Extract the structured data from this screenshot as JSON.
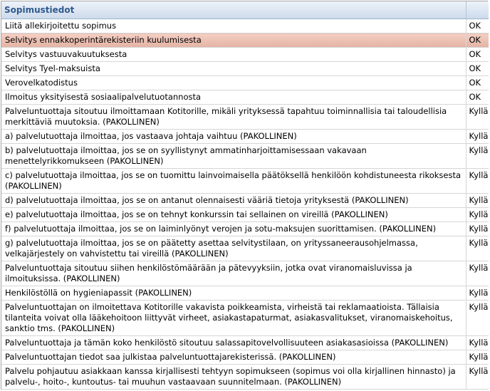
{
  "header": {
    "title": "Sopimustiedot",
    "value_header": ""
  },
  "rows": [
    {
      "label": "Liitä allekirjoitettu sopimus",
      "value": "OK"
    },
    {
      "label": "Selvitys ennakkoperintärekisteriin kuulumisesta",
      "value": "OK",
      "highlighted": true
    },
    {
      "label": "Selvitys vastuuvakuutuksesta",
      "value": "OK"
    },
    {
      "label": "Selvitys Tyel-maksuista",
      "value": "OK"
    },
    {
      "label": "Verovelkatodistus",
      "value": "OK"
    },
    {
      "label": "Ilmoitus yksityisestä sosiaalipalvelutuotannosta",
      "value": "OK"
    },
    {
      "label": "Palveluntuottaja sitoutuu ilmoittamaan Kotitorille, mikäli yrityksessä tapahtuu toiminnallisia tai taloudellisia merkittäviä muutoksia. (PAKOLLINEN)",
      "value": "Kyllä"
    },
    {
      "label": "a) palvelutuottaja ilmoittaa, jos vastaava johtaja vaihtuu (PAKOLLINEN)",
      "value": "Kyllä"
    },
    {
      "label": "b) palvelutuottaja ilmoittaa, jos se on syyllistynyt ammatinharjoittamisessaan vakavaan menettelyrikkomukseen (PAKOLLINEN)",
      "value": "Kyllä"
    },
    {
      "label": "c) palvelutuottaja ilmoittaa, jos se on tuomittu lainvoimaisella päätöksellä henkilöön kohdistuneesta rikoksesta (PAKOLLINEN)",
      "value": "Kyllä"
    },
    {
      "label": "d) palvelutuottaja ilmoittaa, jos se on antanut olennaisesti vääriä tietoja yrityksestä (PAKOLLINEN)",
      "value": "Kyllä"
    },
    {
      "label": "e) palvelutuottaja ilmoittaa, jos se on tehnyt konkurssin tai sellainen on vireillä (PAKOLLINEN)",
      "value": "Kyllä"
    },
    {
      "label": "f) palvelutuottaja ilmoittaa, jos se on laiminlyönyt verojen ja sotu-maksujen suorittamisen. (PAKOLLINEN)",
      "value": "Kyllä"
    },
    {
      "label": "g) palvelutuottaja ilmoittaa, jos se on päätetty asettaa selvitystilaan, on yrityssaneerausohjelmassa, velkajärjestely on vahvistettu tai vireillä (PAKOLLINEN)",
      "value": "Kyllä"
    },
    {
      "label": "Palveluntuottaja sitoutuu siihen henkilöstömäärään ja pätevyyksiin, jotka ovat viranomaisluvissa ja ilmoituksissa. (PAKOLLINEN)",
      "value": "Kyllä"
    },
    {
      "label": "Henkilöstöllä on hygieniapassit (PAKOLLINEN)",
      "value": "Kyllä"
    },
    {
      "label": "Palveluntuottajan on ilmoitettava Kotitorille vakavista poikkeamista, virheistä tai reklamaatioista. Tällaisia tilanteita voivat olla lääkehoitoon liittyvät virheet, asiakastapaturmat, asiakasvalitukset, viranomaiskehoitus, sanktio tms. (PAKOLLINEN)",
      "value": "Kyllä"
    },
    {
      "label": "Palveluntuottaja ja tämän koko henkilöstö sitoutuu salassapitovelvollisuuteen asiakasasioissa (PAKOLLINEN)",
      "value": "Kyllä"
    },
    {
      "label": "Palveluntuottajan tiedot saa julkistaa palveluntuottajarekisterissä. (PAKOLLINEN)",
      "value": "Kyllä"
    },
    {
      "label": "Palvelu pohjautuu asiakkaan kanssa kirjallisesti tehtyyn sopimukseen (sopimus voi olla kirjallinen hinnasto) ja palvelu-, hoito-, kuntoutus- tai muuhun vastaavaan suunnitelmaan. (PAKOLLINEN)",
      "value": "Kyllä"
    }
  ]
}
